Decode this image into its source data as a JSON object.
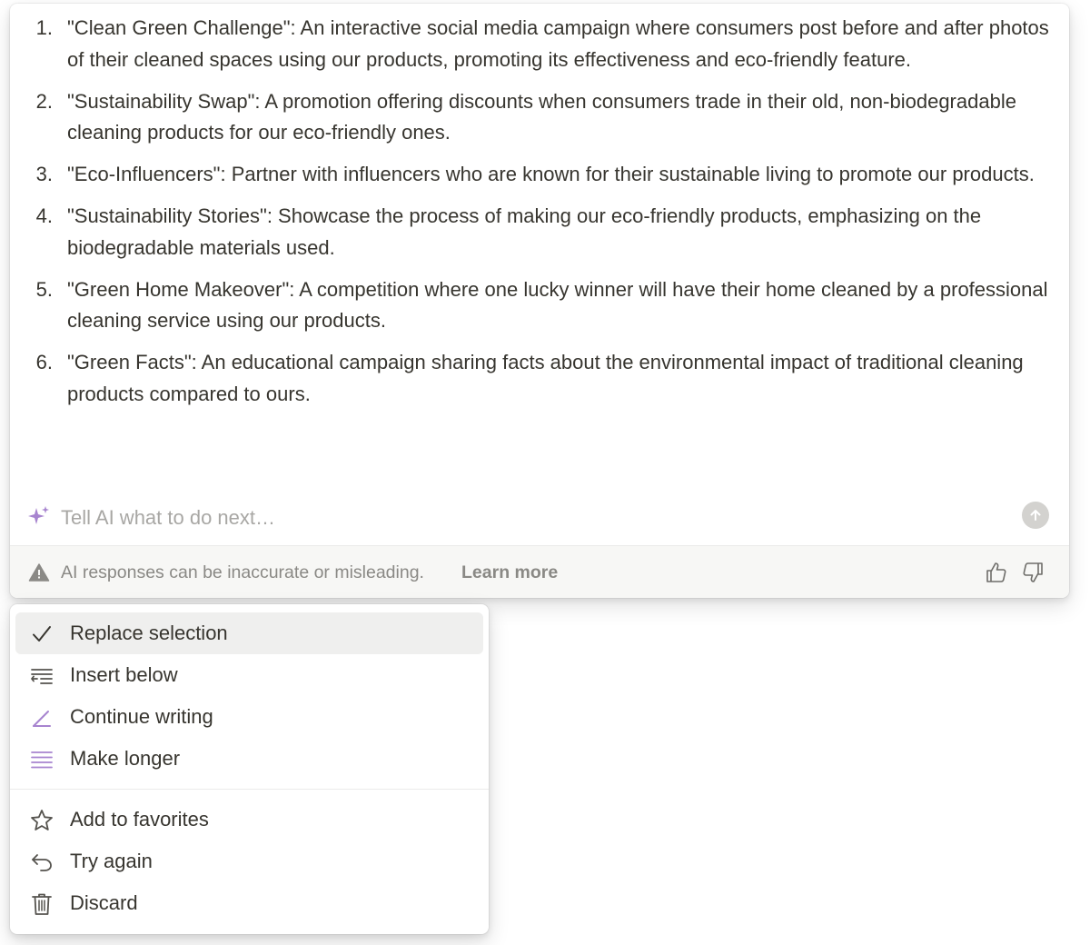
{
  "response": {
    "items": [
      {
        "num": "1.",
        "text": "\"Clean Green Challenge\": An interactive social media campaign where consumers post before and after photos of their cleaned spaces using our products, promoting its effectiveness and eco-friendly feature."
      },
      {
        "num": "2.",
        "text": "\"Sustainability Swap\": A promotion offering discounts when consumers trade in their old, non-biodegradable cleaning products for our eco-friendly ones."
      },
      {
        "num": "3.",
        "text": "\"Eco-Influencers\": Partner with influencers who are known for their sustainable living to promote our products."
      },
      {
        "num": "4.",
        "text": "\"Sustainability Stories\": Showcase the process of making our eco-friendly products, emphasizing on the biodegradable materials used."
      },
      {
        "num": "5.",
        "text": "\"Green Home Makeover\": A competition where one lucky winner will have their home cleaned by a professional cleaning service using our products."
      },
      {
        "num": "6.",
        "text": "\"Green Facts\": An educational campaign sharing facts about the environmental impact of traditional cleaning products compared to ours."
      }
    ]
  },
  "prompt": {
    "placeholder": "Tell AI what to do next…",
    "value": "",
    "sparkle_icon": "sparkle-icon",
    "send_icon": "arrow-up-icon"
  },
  "footer": {
    "warning_text": "AI responses can be inaccurate or misleading.",
    "learn_more_label": "Learn more",
    "warning_icon": "warning-triangle-icon"
  },
  "menu": {
    "primary_items": [
      {
        "label": "Replace selection",
        "icon": "checkmark-icon",
        "selected": true
      },
      {
        "label": "Insert below",
        "icon": "insert-below-icon",
        "selected": false
      },
      {
        "label": "Continue writing",
        "icon": "pencil-line-icon",
        "selected": false
      },
      {
        "label": "Make longer",
        "icon": "lines-icon",
        "selected": false
      }
    ],
    "secondary_items": [
      {
        "label": "Add to favorites",
        "icon": "star-icon"
      },
      {
        "label": "Try again",
        "icon": "undo-arrow-icon"
      },
      {
        "label": "Discard",
        "icon": "trash-icon"
      }
    ]
  },
  "colors": {
    "accent_purple": "#a784cf",
    "text": "#37352f",
    "muted_text": "#8a8985",
    "placeholder": "#a8a7a4",
    "selected_bg": "#efefee",
    "footer_bg": "#f7f7f5"
  }
}
